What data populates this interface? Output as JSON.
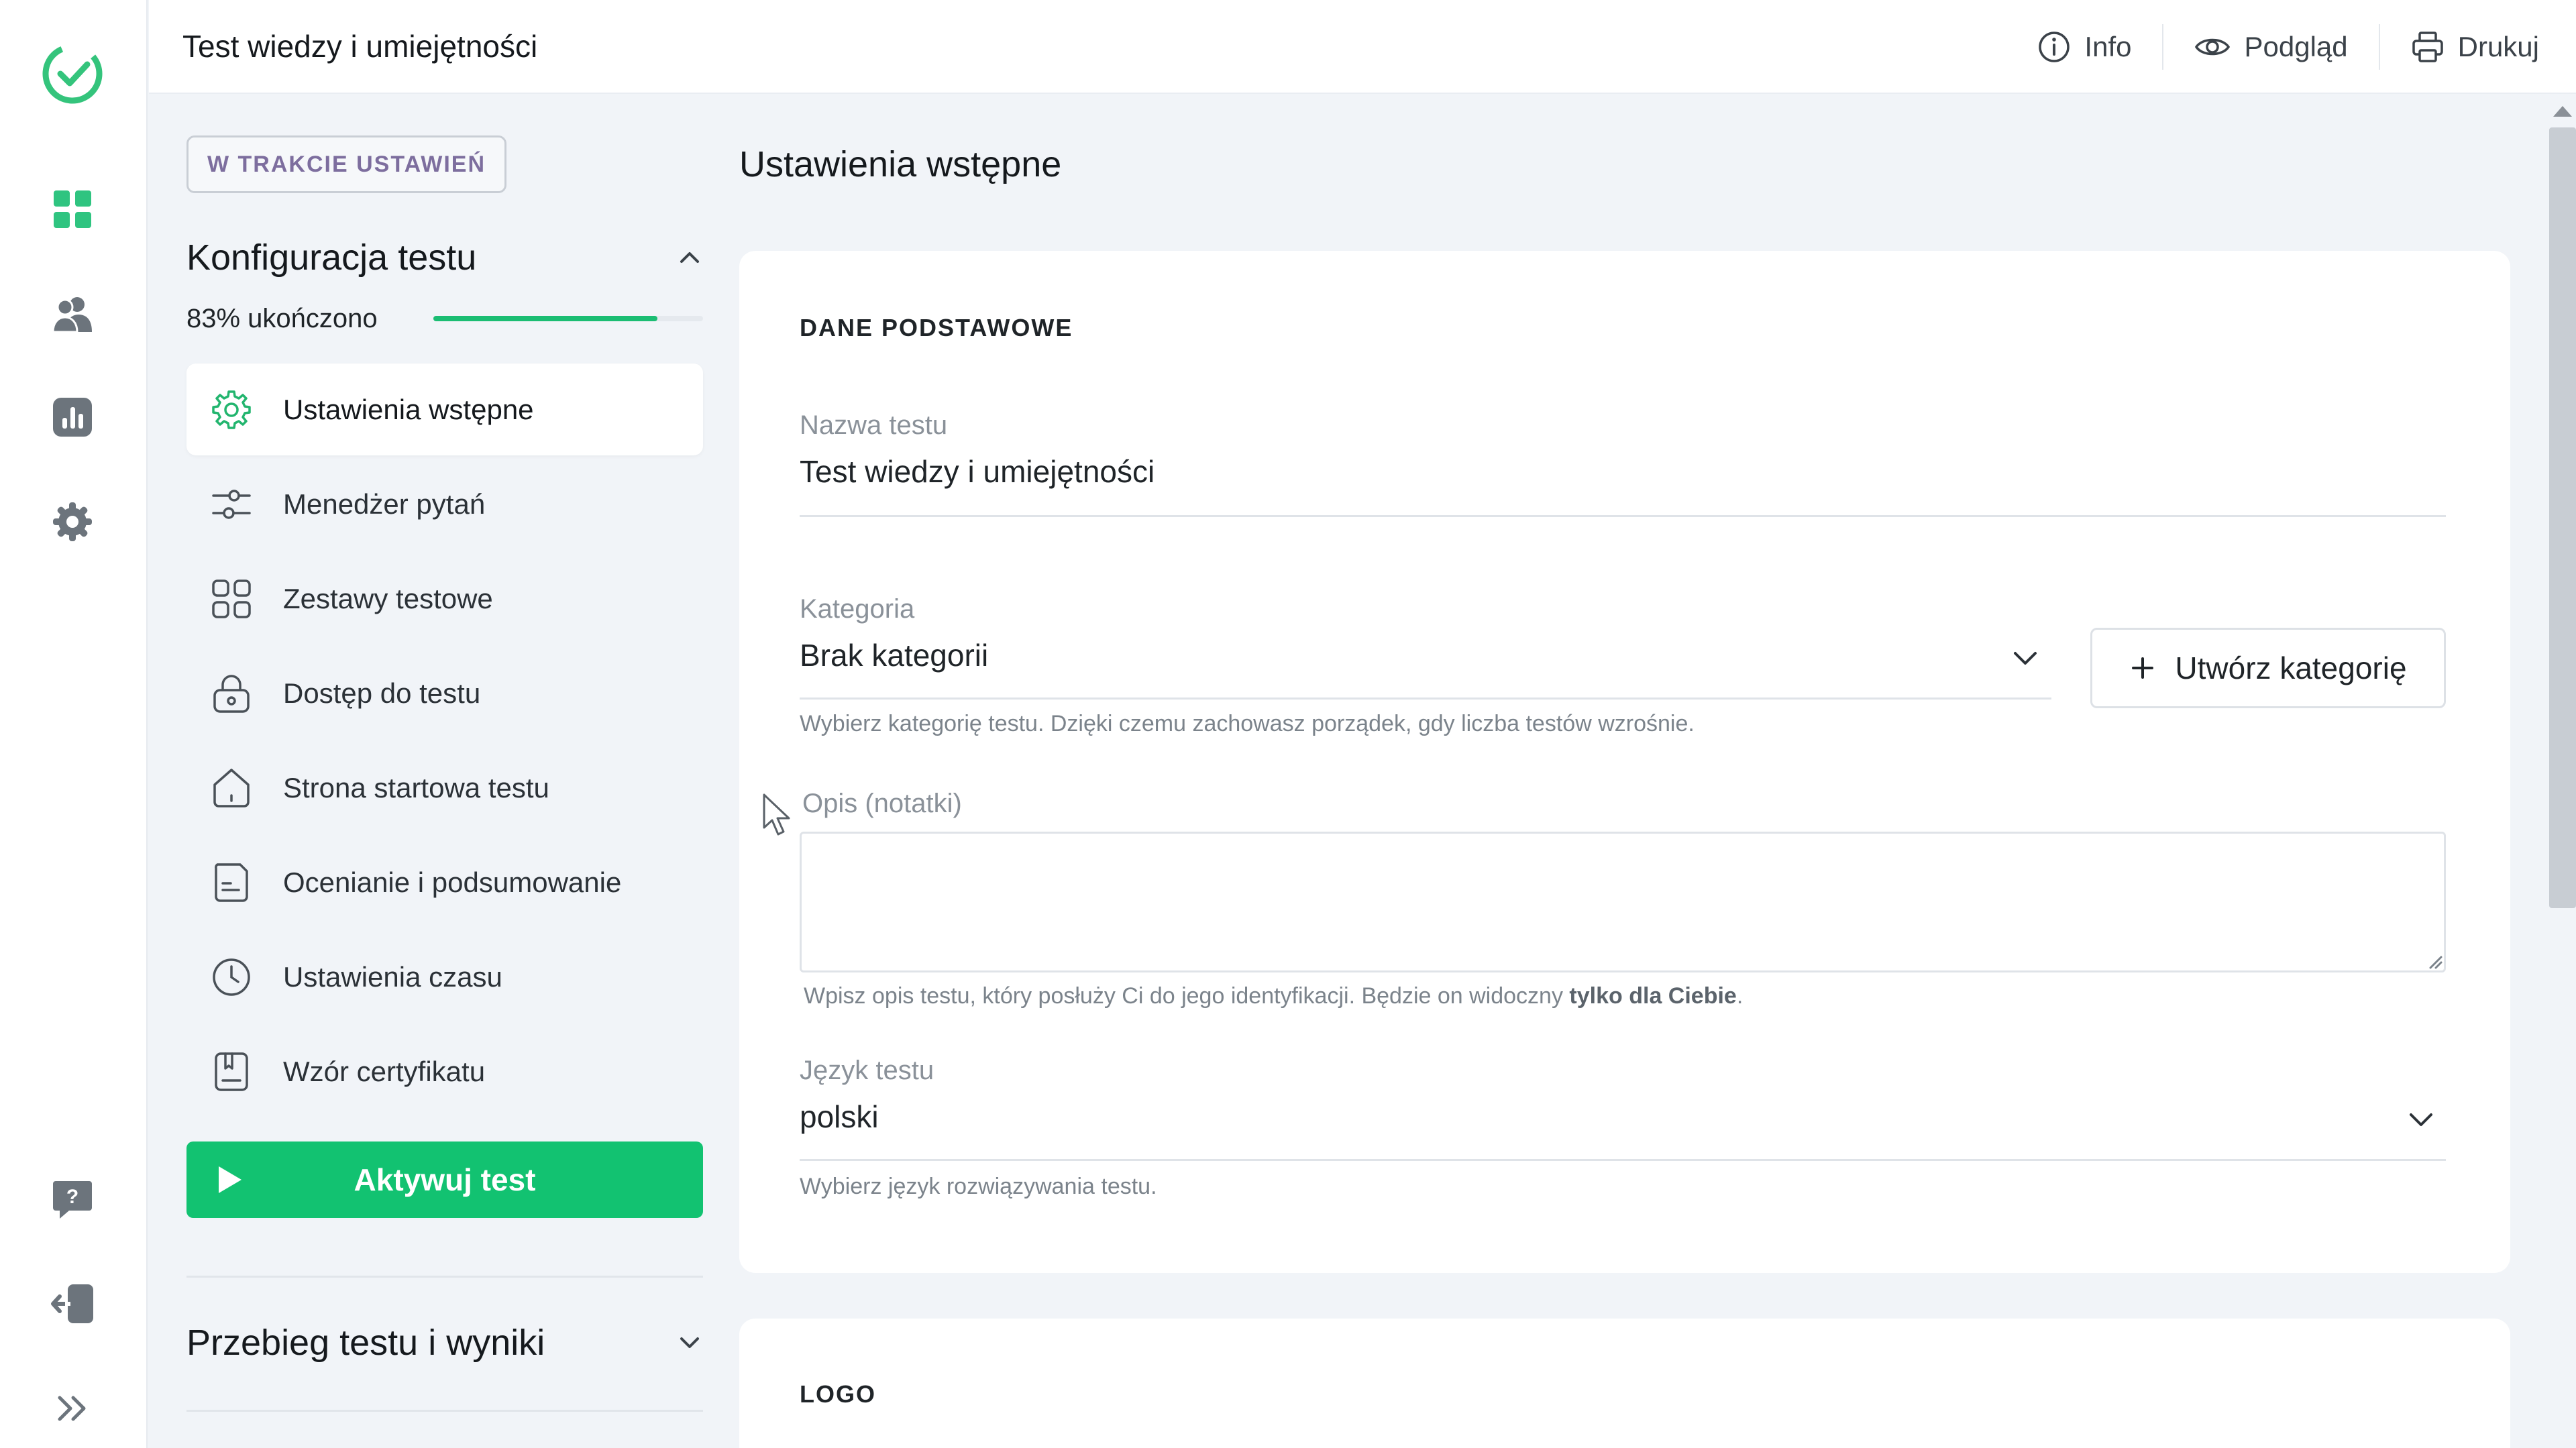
{
  "app": {
    "title": "Test wiedzy i umiejętności",
    "brand_color": "#1bbd73"
  },
  "topbar": {
    "actions": [
      {
        "label": "Info",
        "icon": "info-icon"
      },
      {
        "label": "Podgląd",
        "icon": "eye-icon"
      },
      {
        "label": "Drukuj",
        "icon": "printer-icon"
      }
    ]
  },
  "rail": {
    "items": [
      {
        "name": "logo",
        "icon": "check-circle-logo"
      },
      {
        "name": "dashboard",
        "icon": "grid-icon"
      },
      {
        "name": "users",
        "icon": "users-icon"
      },
      {
        "name": "reports",
        "icon": "chart-icon"
      },
      {
        "name": "settings",
        "icon": "gear-icon"
      },
      {
        "name": "help",
        "icon": "help-icon"
      },
      {
        "name": "logout",
        "icon": "logout-icon"
      },
      {
        "name": "expand",
        "icon": "double-chevron-right-icon"
      }
    ]
  },
  "sidebar": {
    "status_badge": "W TRAKCIE USTAWIEŃ",
    "config_section_title": "Konfiguracja testu",
    "progress_text": "83% ukończono",
    "progress_value": 0.83,
    "nav_items": [
      {
        "label": "Ustawienia wstępne",
        "icon": "gear-icon",
        "active": true
      },
      {
        "label": "Menedżer pytań",
        "icon": "sliders-icon",
        "active": false
      },
      {
        "label": "Zestawy testowe",
        "icon": "grid-outline-icon",
        "active": false
      },
      {
        "label": "Dostęp do testu",
        "icon": "lock-icon",
        "active": false
      },
      {
        "label": "Strona startowa testu",
        "icon": "home-icon",
        "active": false
      },
      {
        "label": "Ocenianie i podsumowanie",
        "icon": "document-icon",
        "active": false
      },
      {
        "label": "Ustawienia czasu",
        "icon": "clock-icon",
        "active": false
      },
      {
        "label": "Wzór certyfikatu",
        "icon": "certificate-icon",
        "active": false
      }
    ],
    "activate_label": "Aktywuj test",
    "results_section_title": "Przebieg testu i wyniki"
  },
  "main": {
    "title": "Ustawienia wstępne",
    "basic_section": {
      "heading": "DANE PODSTAWOWE",
      "name_label": "Nazwa testu",
      "name_value": "Test wiedzy i umiejętności",
      "category_label": "Kategoria",
      "category_value": "Brak kategorii",
      "create_category_label": "Utwórz kategorię",
      "category_helper": "Wybierz kategorię testu. Dzięki czemu zachowasz porządek, gdy liczba testów wzrośnie.",
      "description_label": "Opis (notatki)",
      "description_value": "",
      "description_helper_prefix": "Wpisz opis testu, który posłuży Ci do jego identyfikacji. Będzie on widoczny ",
      "description_helper_bold": "tylko dla Ciebie",
      "description_helper_suffix": ".",
      "language_label": "Język testu",
      "language_value": "polski",
      "language_helper": "Wybierz język rozwiązywania testu."
    },
    "logo_section": {
      "heading": "LOGO"
    }
  }
}
